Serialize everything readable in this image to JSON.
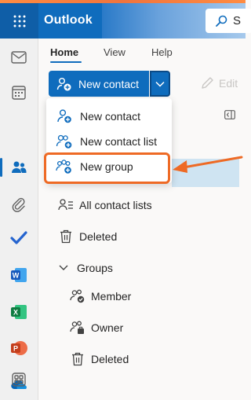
{
  "header": {
    "app_name": "Outlook",
    "search_label": "S"
  },
  "ribbon": {
    "tabs": [
      {
        "label": "Home",
        "selected": true
      },
      {
        "label": "View",
        "selected": false
      },
      {
        "label": "Help",
        "selected": false
      }
    ],
    "new_contact_label": "New contact",
    "edit_label": "Edit"
  },
  "dropdown": {
    "items": [
      {
        "label": "New contact"
      },
      {
        "label": "New contact list"
      },
      {
        "label": "New group",
        "highlighted": true
      }
    ]
  },
  "sidebar": {
    "all_contact_lists": "All contact lists",
    "deleted": "Deleted",
    "groups_header": "Groups",
    "groups": [
      {
        "label": "Member"
      },
      {
        "label": "Owner"
      },
      {
        "label": "Deleted"
      }
    ]
  },
  "colors": {
    "brand": "#0f6cbd",
    "highlight": "#ee6a25",
    "selected": "#cfe4f2"
  },
  "icons": [
    "app-launcher-icon",
    "mail-icon",
    "calendar-icon",
    "people-icon",
    "attachment-icon",
    "todo-icon",
    "word-icon",
    "excel-icon",
    "powerpoint-icon",
    "onedrive-icon",
    "more-apps-icon"
  ]
}
